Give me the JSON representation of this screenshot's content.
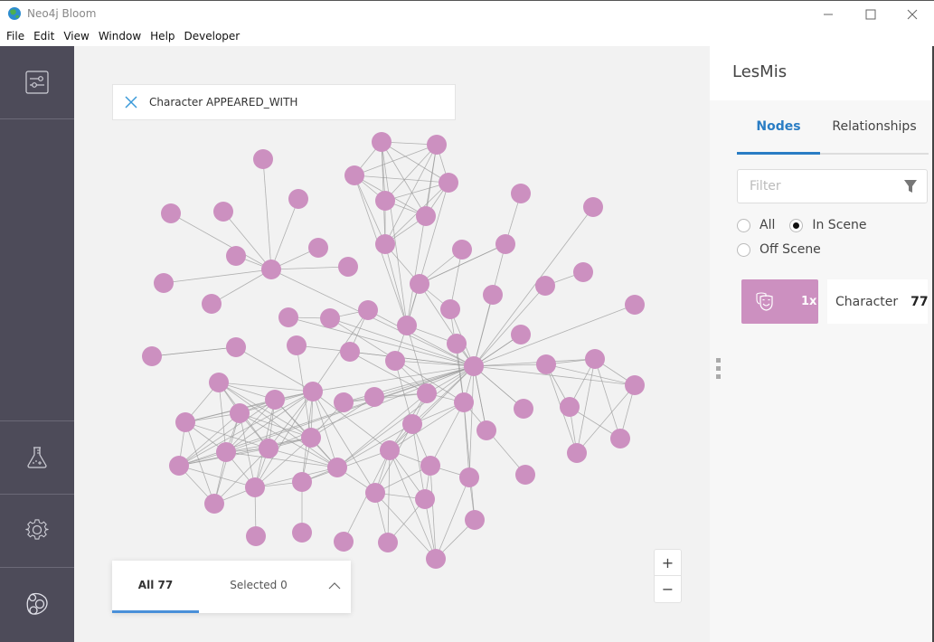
{
  "window": {
    "title": "Neo4j Bloom",
    "controls": [
      "minimize",
      "maximize",
      "close"
    ]
  },
  "menu": {
    "items": [
      "File",
      "Edit",
      "View",
      "Window",
      "Help",
      "Developer"
    ]
  },
  "left_rail": {
    "top_buttons": [
      {
        "icon": "sliders-icon",
        "label": "Perspective"
      }
    ],
    "bottom_buttons": [
      {
        "icon": "flask-icon",
        "label": "Experimental"
      },
      {
        "icon": "gear-icon",
        "label": "Settings"
      },
      {
        "icon": "bloom-icon",
        "label": "About"
      }
    ]
  },
  "canvas": {
    "search": {
      "text": "Character APPEARED_WITH",
      "clear_icon": "close-icon"
    },
    "results": {
      "tabs": [
        {
          "label": "All 77",
          "active": true
        },
        {
          "label": "Selected 0",
          "active": false
        }
      ],
      "toggle_icon": "chevron-up-icon"
    },
    "zoom": {
      "in_label": "+",
      "out_label": "−"
    },
    "graph": {
      "node_color": "#cc90c0",
      "edge_color": "#9a9a9a",
      "node_count": 77
    }
  },
  "right_panel": {
    "title": "LesMis",
    "tabs": [
      {
        "label": "Nodes",
        "active": true
      },
      {
        "label": "Relationships",
        "active": false
      }
    ],
    "filter": {
      "placeholder": "Filter",
      "value": "",
      "icon": "filter-icon"
    },
    "scope": {
      "options": [
        {
          "label": "All",
          "selected": false
        },
        {
          "label": "In Scene",
          "selected": true
        },
        {
          "label": "Off Scene",
          "selected": false
        }
      ]
    },
    "categories": [
      {
        "name": "Character",
        "count": "77",
        "size": "1x",
        "color": "#cc90c0",
        "icon": "theater-masks-icon"
      }
    ]
  }
}
